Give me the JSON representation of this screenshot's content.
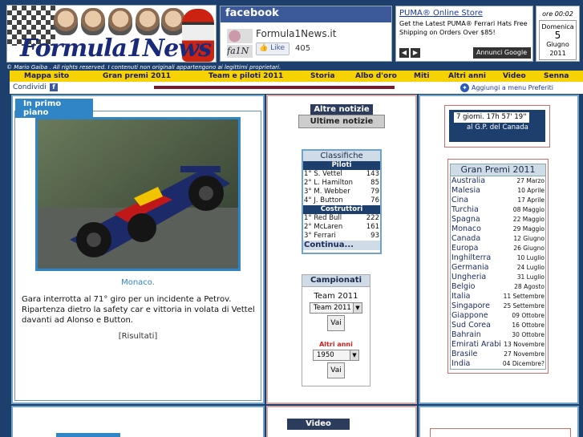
{
  "header": {
    "logo_text": "Formula1News",
    "facebook": {
      "title": "facebook",
      "thumb": "fa1N",
      "page_name": "Formula1News.it",
      "like_label": "Like",
      "like_count": "405"
    },
    "ad": {
      "title": "PUMA® Online Store",
      "text": "Get the Latest PUMA® Ferrari Hats Free Shipping on Orders Over $85!",
      "label": "Annunci Google",
      "prev_icon": "chevron-left-icon",
      "next_icon": "chevron-right-icon"
    },
    "clock": "ore 00:02",
    "date": {
      "weekday": "Domenica",
      "day": "5",
      "month": "Giugno",
      "year": "2011"
    }
  },
  "copyright": "© Mario Gaiba . All rights reserved. I contenuti non originali appartengono ai legittimi proprietari.",
  "nav": {
    "items": [
      {
        "label": "Mappa sito"
      },
      {
        "label": "Gran premi 2011"
      },
      {
        "label": "Team e piloti 2011"
      },
      {
        "label": "Storia"
      },
      {
        "label": "Albo d'oro"
      },
      {
        "label": "Miti"
      },
      {
        "label": "Altri anni"
      },
      {
        "label": "Video"
      },
      {
        "label": "Senna"
      }
    ]
  },
  "share": {
    "label": "Condividi",
    "fb_icon": "f",
    "fav_label": "Aggiungi a menu Preferiti"
  },
  "left": {
    "tag": "In primo piano",
    "caption": "Monaco.",
    "story": "Gara interrotta al 71° giro per un incidente a Petrov. Ripartenza dietro la safety car e vittoria in volata di Vettel davanti ad Alonso e Button.",
    "results": "[Risultati]"
  },
  "middle": {
    "altre_notizie": "Altre notizie",
    "ultime_notizie": "Ultime notizie",
    "standings": {
      "title": "Classifiche",
      "drivers_label": "Piloti",
      "drivers": [
        {
          "pos": "1° S. Vettel",
          "pts": "143"
        },
        {
          "pos": "2° L. Hamilton",
          "pts": "85"
        },
        {
          "pos": "3° M. Webber",
          "pts": "79"
        },
        {
          "pos": "4° J. Button",
          "pts": "76"
        }
      ],
      "teams_label": "Costruttori",
      "teams": [
        {
          "pos": "1° Red Bull",
          "pts": "222"
        },
        {
          "pos": "2° McLaren",
          "pts": "161"
        },
        {
          "pos": "3° Ferrari",
          "pts": "93"
        }
      ],
      "more": "Continua..."
    },
    "championships": {
      "title": "Campionati",
      "team_label": "Team 2011",
      "team_select": "Team 2011",
      "go": "Vai",
      "other_years": "Altri anni",
      "year_select": "1950",
      "go2": "Vai"
    },
    "video_tag": "Video"
  },
  "right": {
    "countdown_time": "7 giorni. 17h 57' 19''",
    "countdown_label": "al G.P. del Canada",
    "gp_title": "Gran Premi 2011",
    "races": [
      {
        "name": "Australia",
        "date": "27 Marzo"
      },
      {
        "name": "Malesia",
        "date": "10 Aprile"
      },
      {
        "name": "Cina",
        "date": "17 Aprile"
      },
      {
        "name": "Turchia",
        "date": "08 Maggio"
      },
      {
        "name": "Spagna",
        "date": "22 Maggio"
      },
      {
        "name": "Monaco",
        "date": "29 Maggio"
      },
      {
        "name": "Canada",
        "date": "12 Giugno"
      },
      {
        "name": "Europa",
        "date": "26 Giugno"
      },
      {
        "name": "Inghilterra",
        "date": "10 Luglio"
      },
      {
        "name": "Germania",
        "date": "24 Luglio"
      },
      {
        "name": "Ungheria",
        "date": "31 Luglio"
      },
      {
        "name": "Belgio",
        "date": "28 Agosto"
      },
      {
        "name": "Italia",
        "date": "11 Settembre"
      },
      {
        "name": "Singapore",
        "date": "25 Settembre"
      },
      {
        "name": "Giappone",
        "date": "09 Ottobre"
      },
      {
        "name": "Sud Corea",
        "date": "16 Ottobre"
      },
      {
        "name": "Bahrain",
        "date": "30 Ottobre"
      },
      {
        "name": "Emirati Arabi",
        "date": "13 Novembre"
      },
      {
        "name": "Brasile",
        "date": "27 Novembre"
      },
      {
        "name": "India",
        "date": "04 Dicembre?"
      }
    ]
  }
}
